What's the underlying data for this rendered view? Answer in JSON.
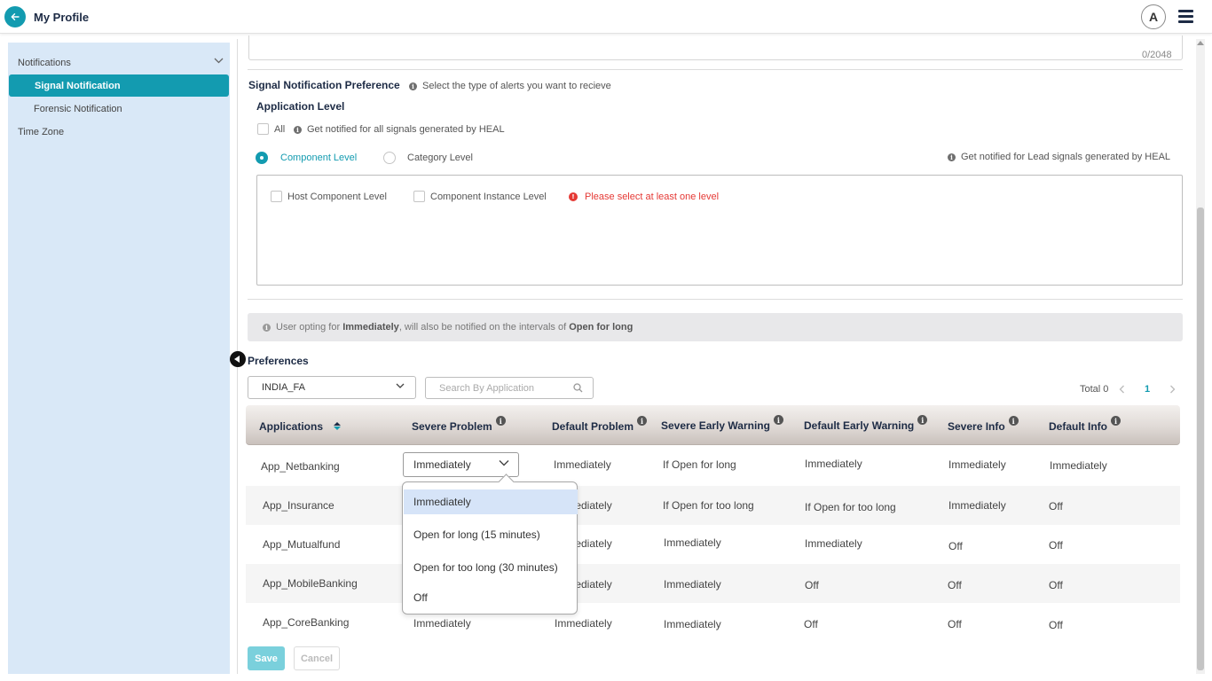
{
  "header": {
    "title": "My Profile",
    "avatar_initial": "A"
  },
  "sidebar": {
    "items": [
      {
        "label": "Notifications"
      },
      {
        "label": "Signal Notification"
      },
      {
        "label": "Forensic Notification"
      },
      {
        "label": "Time Zone"
      }
    ]
  },
  "form": {
    "char_count": "0/2048",
    "section_title": "Signal Notification Preference",
    "section_hint": "Select the type of alerts you want to recieve",
    "app_level_title": "Application Level",
    "all_label": "All",
    "all_hint": "Get notified for all signals generated by HEAL",
    "component_level": "Component Level",
    "category_level": "Category Level",
    "lead_hint": "Get notified for Lead signals generated by HEAL",
    "host_component_level": "Host Component Level",
    "component_instance_level": "Component Instance Level",
    "error": "Please select at least one level",
    "banner": {
      "prefix": "User opting for",
      "bold1": "Immediately",
      "middle": ", will also be notified on the intervals of",
      "bold2": "Open for long"
    }
  },
  "preferences": {
    "title": "Preferences",
    "account_select": "INDIA_FA",
    "search_placeholder": "Search By Application",
    "total_label": "Total 0",
    "current_page": "1",
    "columns": [
      "Applications",
      "Severe Problem",
      "Default Problem",
      "Severe Early Warning",
      "Default Early Warning",
      "Severe Info",
      "Default Info"
    ],
    "rows": [
      {
        "app": "App_Netbanking",
        "severe_problem": "Immediately",
        "default_problem": "Immediately",
        "severe_ew": "If Open for long",
        "default_ew": "Immediately",
        "severe_info": "Immediately",
        "default_info": "Immediately"
      },
      {
        "app": "App_Insurance",
        "severe_problem": "",
        "default_problem": "Immediately",
        "severe_ew": "If Open for too long",
        "default_ew": "If Open for too long",
        "severe_info": "Immediately",
        "default_info": "Off"
      },
      {
        "app": "App_Mutualfund",
        "severe_problem": "",
        "default_problem": "Immediately",
        "severe_ew": "Immediately",
        "default_ew": "Immediately",
        "severe_info": "Off",
        "default_info": "Off"
      },
      {
        "app": "App_MobileBanking",
        "severe_problem": "",
        "default_problem": "Immediately",
        "severe_ew": "Immediately",
        "default_ew": "Off",
        "severe_info": "Off",
        "default_info": "Off"
      },
      {
        "app": "App_CoreBanking",
        "severe_problem": "Immediately",
        "default_problem": "Immediately",
        "severe_ew": "Immediately",
        "default_ew": "Off",
        "severe_info": "Off",
        "default_info": "Off"
      }
    ],
    "dropdown_options": [
      "Immediately",
      "Open for long (15 minutes)",
      "Open for too long (30 minutes)",
      "Off"
    ]
  },
  "actions": {
    "save": "Save",
    "cancel": "Cancel"
  },
  "colors": {
    "accent": "#139bb0",
    "error": "#e53935",
    "sidebar_bg": "#d9e8f7",
    "title": "#1d2b45"
  }
}
